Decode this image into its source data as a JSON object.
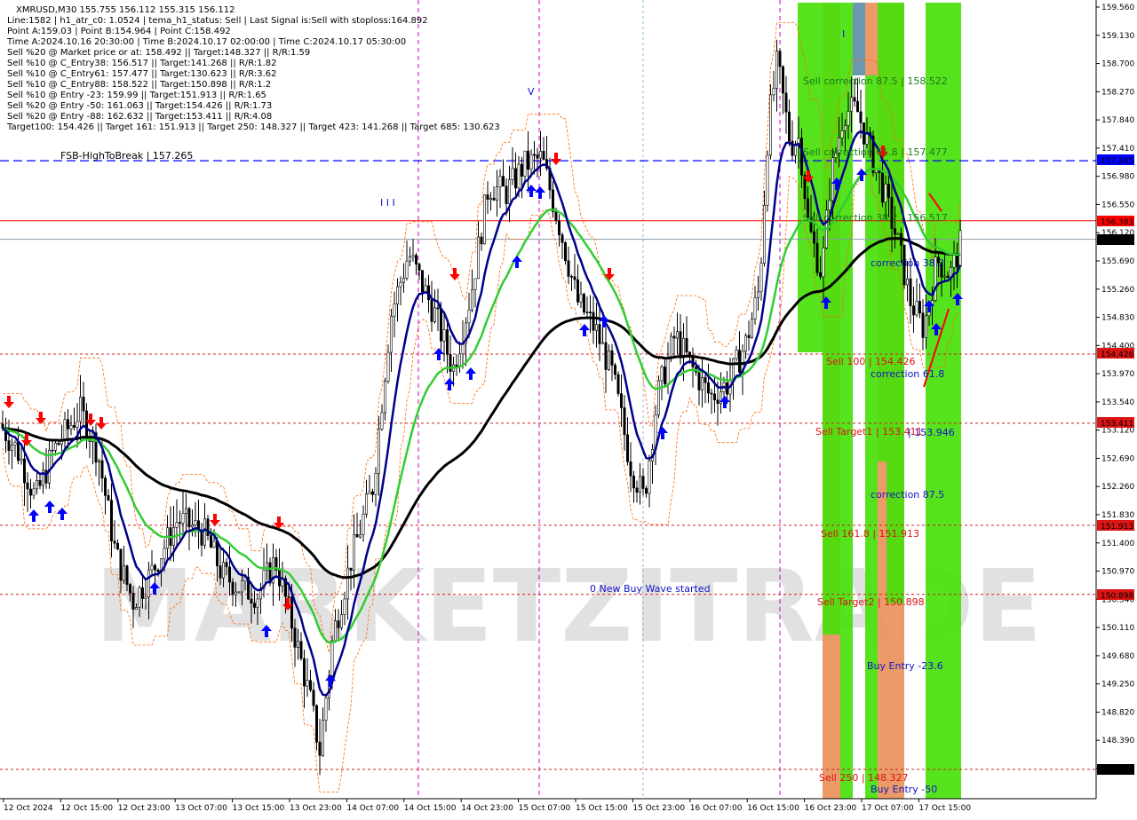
{
  "info": {
    "lines": [
      "XMRUSD,M30   155.755 156.112 155.315 156.112",
      "Line:1582 | h1_atr_c0: 1.0524 | tema_h1_status: Sell | Last Signal is:Sell with stoploss:164.892",
      "Point A:159.03 | Point B:154.964 | Point C:158.492",
      "Time A:2024.10.16 20:30:00 | Time B:2024.10.17 02:00:00 | Time C:2024.10.17 05:30:00",
      "Sell %20 @ Market price or at: 158.492 || Target:148.327 || R/R:1.59",
      "Sell %10 @ C_Entry38: 156.517 || Target:141.268 || R/R:1.82",
      "Sell %10 @ C_Entry61: 157.477 || Target:130.623 || R/R:3.62",
      "Sell %10 @ C_Entry88: 158.522 || Target:150.898 || R/R:1.2",
      "Sell %10 @ Entry -23: 159.99 || Target:151.913 || R/R:1.65",
      "Sell %20 @ Entry -50: 161.063 || Target:154.426 || R/R:1.73",
      "Sell %20 @ Entry -88: 162.632 || Target:153.411 || R/R:4.08",
      "Target100: 154.426 || Target 161: 151.913 || Target 250: 148.327 || Target 423: 141.268 || Target 685: 130.623"
    ]
  },
  "watermark": "MARKETZITRADE",
  "colors": {
    "bull": "#000000",
    "bear": "#000000",
    "blue_ma": "#00008b",
    "green_ma": "#32cd32",
    "black_ma": "#000000",
    "red_line": "#ff0000",
    "blue_line": "#0000ff",
    "label_red": "#dc1414",
    "bright_green": "#49e00b",
    "salmon": "#e8925a",
    "steel": "#5f8fa8"
  },
  "price_labels": [
    {
      "value": "157.265",
      "color": "#0000ff"
    },
    {
      "value": "156.383",
      "color": "#ff0000"
    },
    {
      "value": "156.112",
      "color": "#000000"
    },
    {
      "value": "154.426",
      "color": "#dc1414"
    },
    {
      "value": "153.411",
      "color": "#dc1414"
    },
    {
      "value": "151.913",
      "color": "#dc1414"
    },
    {
      "value": "150.898",
      "color": "#dc1414"
    },
    {
      "value": "148.327",
      "color": "#000000"
    }
  ],
  "annotations": {
    "fsb": "FSB-HighToBreak | 157.265",
    "sell_corr_875": "Sell correction 87.5 | 158.522",
    "sell_corr_618": "Sell correction 61.8 | 157.477",
    "sell_corr_382": "Sell correction 38.2 | 156.517",
    "correction_382": "correction 38.2",
    "sell_100": "Sell 100 | 154.426",
    "correction_618": "correction 61.8",
    "sell_target1": "Sell Target1 | 153.411",
    "value_153946": "| 153.946",
    "correction_875": "correction 87.5",
    "sell_1618": "Sell 161.8 | 151.913",
    "new_buy_wave": "0 New Buy Wave started",
    "sell_target2": "Sell Target2 | 150.898",
    "buy_entry_236": "Buy Entry -23.6",
    "sell_250": "Sell 250 | 148.327",
    "buy_entry_50": "Buy Entry -50",
    "marker_iii": "I I I",
    "marker_v": "V",
    "marker_i": "I"
  },
  "chart_data": {
    "type": "candlestick",
    "symbol": "XMRUSD",
    "timeframe": "M30",
    "y_ticks": [
      "159.560",
      "159.130",
      "158.700",
      "158.270",
      "157.840",
      "157.410",
      "156.980",
      "156.550",
      "156.120",
      "155.690",
      "155.260",
      "154.830",
      "154.400",
      "153.970",
      "153.540",
      "153.120",
      "152.690",
      "152.260",
      "151.830",
      "151.400",
      "150.970",
      "150.540",
      "150.110",
      "149.680",
      "149.250",
      "148.820",
      "148.390",
      "147.960"
    ],
    "ylim": [
      147.8,
      159.6
    ],
    "x_ticks": [
      "12 Oct 2024",
      "12 Oct 15:00",
      "12 Oct 23:00",
      "13 Oct 07:00",
      "13 Oct 15:00",
      "13 Oct 23:00",
      "14 Oct 07:00",
      "14 Oct 15:00",
      "14 Oct 23:00",
      "15 Oct 07:00",
      "15 Oct 15:00",
      "15 Oct 23:00",
      "16 Oct 07:00",
      "16 Oct 15:00",
      "16 Oct 23:00",
      "17 Oct 07:00",
      "17 Oct 15:00"
    ],
    "last_price": {
      "open": 155.755,
      "high": 156.112,
      "low": 155.315,
      "close": 156.112
    },
    "levels": [
      {
        "name": "FSB-HighToBreak",
        "value": 157.265
      },
      {
        "name": "red-line",
        "value": 156.383
      },
      {
        "name": "current",
        "value": 156.112
      },
      {
        "name": "Sell 100",
        "value": 154.426
      },
      {
        "name": "Sell Target1",
        "value": 153.411
      },
      {
        "name": "Sell 161.8",
        "value": 151.913
      },
      {
        "name": "Sell Target2",
        "value": 150.898
      },
      {
        "name": "Sell 250",
        "value": 148.327
      }
    ],
    "path": [
      [
        0,
        153.4
      ],
      [
        20,
        153.0
      ],
      [
        40,
        152.3
      ],
      [
        60,
        153.0
      ],
      [
        90,
        153.6
      ],
      [
        110,
        153.0
      ],
      [
        130,
        151.5
      ],
      [
        150,
        150.8
      ],
      [
        170,
        151.2
      ],
      [
        200,
        152.0
      ],
      [
        230,
        151.8
      ],
      [
        250,
        151.2
      ],
      [
        270,
        151.0
      ],
      [
        290,
        150.9
      ],
      [
        310,
        151.4
      ],
      [
        330,
        150.4
      ],
      [
        350,
        149.3
      ],
      [
        360,
        148.6
      ],
      [
        375,
        150.3
      ],
      [
        395,
        151.4
      ],
      [
        420,
        152.5
      ],
      [
        440,
        155.0
      ],
      [
        460,
        155.9
      ],
      [
        490,
        155.0
      ],
      [
        510,
        154.2
      ],
      [
        530,
        155.3
      ],
      [
        550,
        156.9
      ],
      [
        570,
        156.8
      ],
      [
        590,
        157.2
      ],
      [
        610,
        157.3
      ],
      [
        630,
        156.3
      ],
      [
        650,
        155.2
      ],
      [
        670,
        154.8
      ],
      [
        690,
        154.1
      ],
      [
        710,
        152.8
      ],
      [
        725,
        152.3
      ],
      [
        740,
        153.8
      ],
      [
        760,
        154.7
      ],
      [
        780,
        154.2
      ],
      [
        800,
        153.8
      ],
      [
        820,
        154.0
      ],
      [
        840,
        154.6
      ],
      [
        855,
        155.4
      ],
      [
        865,
        157.8
      ],
      [
        875,
        158.7
      ],
      [
        890,
        157.5
      ],
      [
        900,
        157.6
      ],
      [
        910,
        156.3
      ],
      [
        925,
        155.6
      ],
      [
        935,
        157.0
      ],
      [
        950,
        158.0
      ],
      [
        965,
        158.0
      ],
      [
        980,
        157.4
      ],
      [
        995,
        156.8
      ],
      [
        1010,
        156.1
      ],
      [
        1025,
        155.2
      ],
      [
        1040,
        154.8
      ],
      [
        1055,
        155.8
      ],
      [
        1070,
        155.6
      ],
      [
        1083,
        156.1
      ]
    ]
  }
}
